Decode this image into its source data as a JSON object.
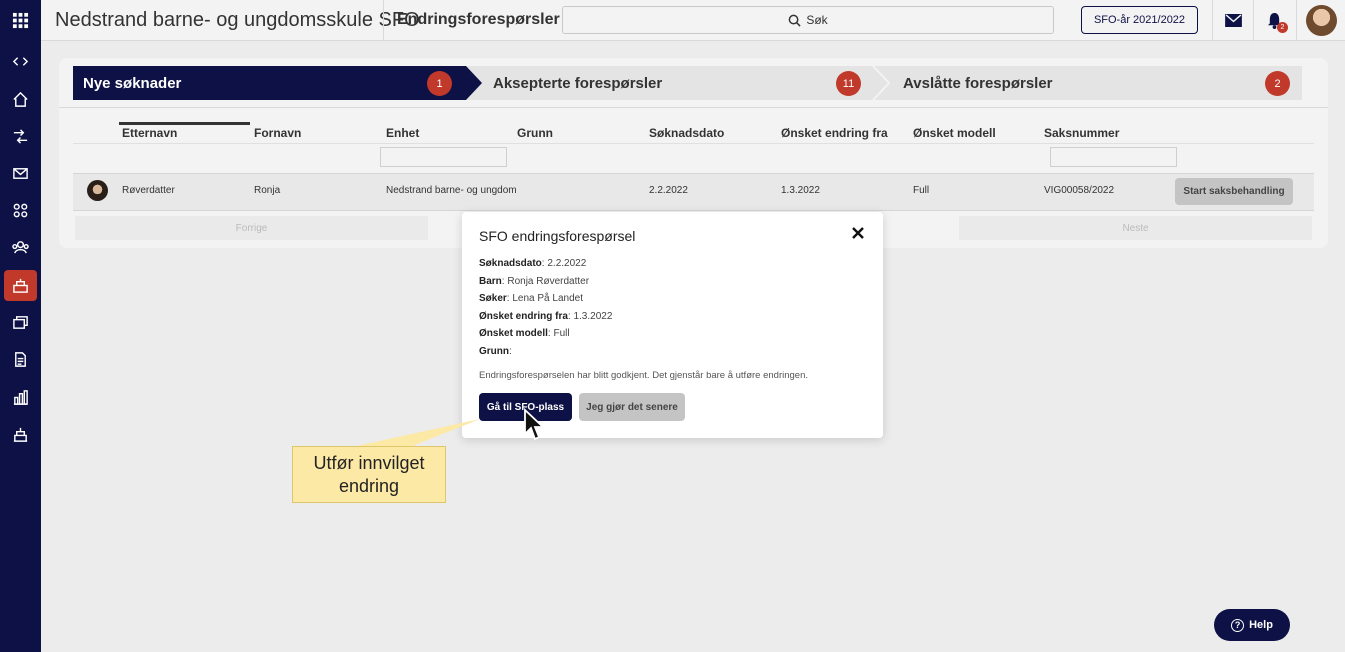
{
  "header": {
    "app_title": "Nedstrand barne- og ungdomsskule SFO",
    "page_title": "Endringsforespørsler",
    "search_placeholder": "Søk",
    "year_button": "SFO-år 2021/2022",
    "notification_count": "2"
  },
  "steps": [
    {
      "label": "Nye søknader",
      "count": "1"
    },
    {
      "label": "Aksepterte forespørsler",
      "count": "11"
    },
    {
      "label": "Avslåtte forespørsler",
      "count": "2"
    }
  ],
  "table": {
    "columns": [
      "Etternavn",
      "Fornavn",
      "Enhet",
      "Grunn",
      "Søknadsdato",
      "Ønsket endring fra",
      "Ønsket modell",
      "Saksnummer"
    ],
    "row": {
      "etternavn": "Røverdatter",
      "fornavn": "Ronja",
      "enhet": "Nedstrand barne- og ungdom",
      "grunn": "",
      "soknadsdato": "2.2.2022",
      "onsket_endring_fra": "1.3.2022",
      "onsket_modell": "Full",
      "saksnummer": "VIG00058/2022",
      "action": "Start saksbehandling"
    },
    "prev": "Forrige",
    "next": "Neste"
  },
  "modal": {
    "title": "SFO endringsforespørsel",
    "fields": [
      {
        "label": "Søknadsdato",
        "value": "2.2.2022"
      },
      {
        "label": "Barn",
        "value": "Ronja Røverdatter"
      },
      {
        "label": "Søker",
        "value": "Lena På Landet"
      },
      {
        "label": "Ønsket endring fra",
        "value": "1.3.2022"
      },
      {
        "label": "Ønsket modell",
        "value": "Full"
      },
      {
        "label": "Grunn",
        "value": ""
      }
    ],
    "note": "Endringsforespørselen har blitt godkjent. Det gjenstår bare å utføre endringen.",
    "primary_button": "Gå til SFO-plass",
    "secondary_button": "Jeg gjør det senere"
  },
  "callout": {
    "line1": "Utfør innvilget",
    "line2": "endring"
  },
  "help_button": "Help",
  "colors": {
    "navy": "#0d1145",
    "badge_red": "#c0392b",
    "callout_yellow": "#fde9a6"
  }
}
